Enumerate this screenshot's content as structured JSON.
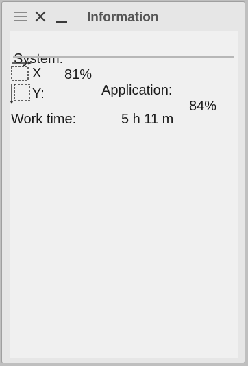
{
  "window": {
    "title": "Information",
    "controls": [
      "menu-icon",
      "close-icon",
      "minimize-icon"
    ]
  },
  "usage": {
    "system_label": "System:",
    "system_value": "81%",
    "application_label": "Application:",
    "application_value": "84%"
  },
  "coordinates": {
    "x_label": "X",
    "y_label": "Y:"
  },
  "work_time": {
    "label": "Work time:",
    "value": "5 h 11 m"
  },
  "colors": {
    "window_bg": "#e6e6e6",
    "content_bg": "#f0f0f0",
    "title_text": "#555555",
    "text": "#1a1a1a"
  }
}
